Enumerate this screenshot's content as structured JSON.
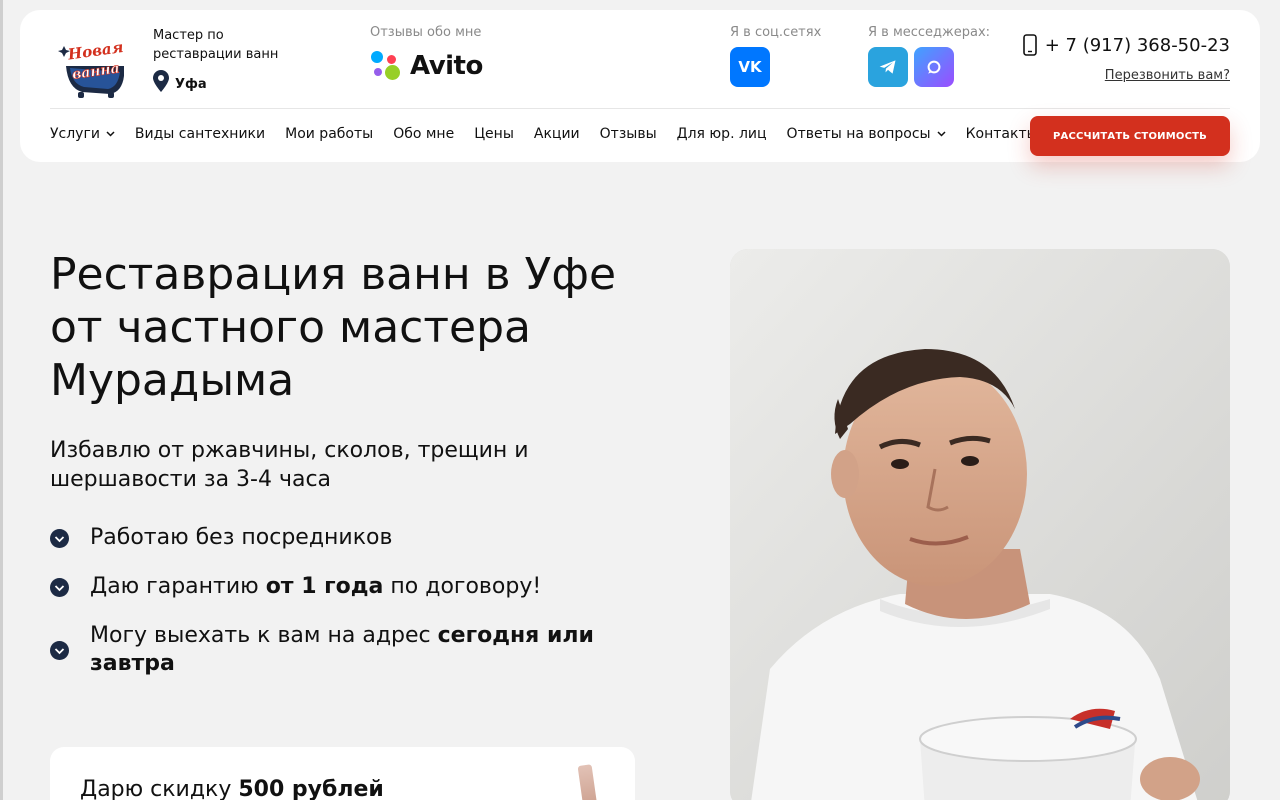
{
  "header": {
    "logo_alt": "Новая ванна",
    "master_line1": "Мастер по",
    "master_line2": "реставрации ванн",
    "city": "Уфа",
    "reviews_label": "Отзывы обо мне",
    "avito_label": "Avito",
    "social_label": "Я в соц.сетях",
    "vk_label": "VK",
    "messengers_label": "Я в месседжерах:",
    "phone": "+ 7 (917) 368-50-23",
    "callback": "Перезвонить вам?",
    "cta": "РАССЧИТАТЬ СТОИМОСТЬ"
  },
  "nav": {
    "items": [
      {
        "label": "Услуги",
        "dropdown": true
      },
      {
        "label": "Виды сантехники",
        "dropdown": false
      },
      {
        "label": "Мои работы",
        "dropdown": false
      },
      {
        "label": "Обо мне",
        "dropdown": false
      },
      {
        "label": "Цены",
        "dropdown": false
      },
      {
        "label": "Акции",
        "dropdown": false
      },
      {
        "label": "Отзывы",
        "dropdown": false
      },
      {
        "label": "Для юр. лиц",
        "dropdown": false
      },
      {
        "label": "Ответы на вопросы",
        "dropdown": true
      },
      {
        "label": "Контакты",
        "dropdown": false
      }
    ]
  },
  "hero": {
    "title_line1": "Реставрация ванн в Уфе",
    "title_line2": "от частного мастера",
    "title_line3": "Мурадыма",
    "subtitle_line1": "Избавлю от ржавчины, сколов, трещин и",
    "subtitle_line2": "шершавости за 3-4 часа",
    "features": [
      {
        "pre": "Работаю без посредников",
        "bold": "",
        "post": ""
      },
      {
        "pre": "Даю гарантию ",
        "bold": "от 1 года",
        "post": " по договору!"
      },
      {
        "pre": "Могу выехать к вам на адрес ",
        "bold": "сегодня или завтра",
        "post": ""
      }
    ]
  },
  "promo": {
    "pre": "Дарю скидку ",
    "bold": "500 рублей"
  },
  "colors": {
    "accent_red": "#d3301e",
    "dark_navy": "#1c2a44",
    "vk_blue": "#0077ff",
    "telegram_blue": "#2aa3de",
    "page_bg": "#f2f2f2"
  }
}
